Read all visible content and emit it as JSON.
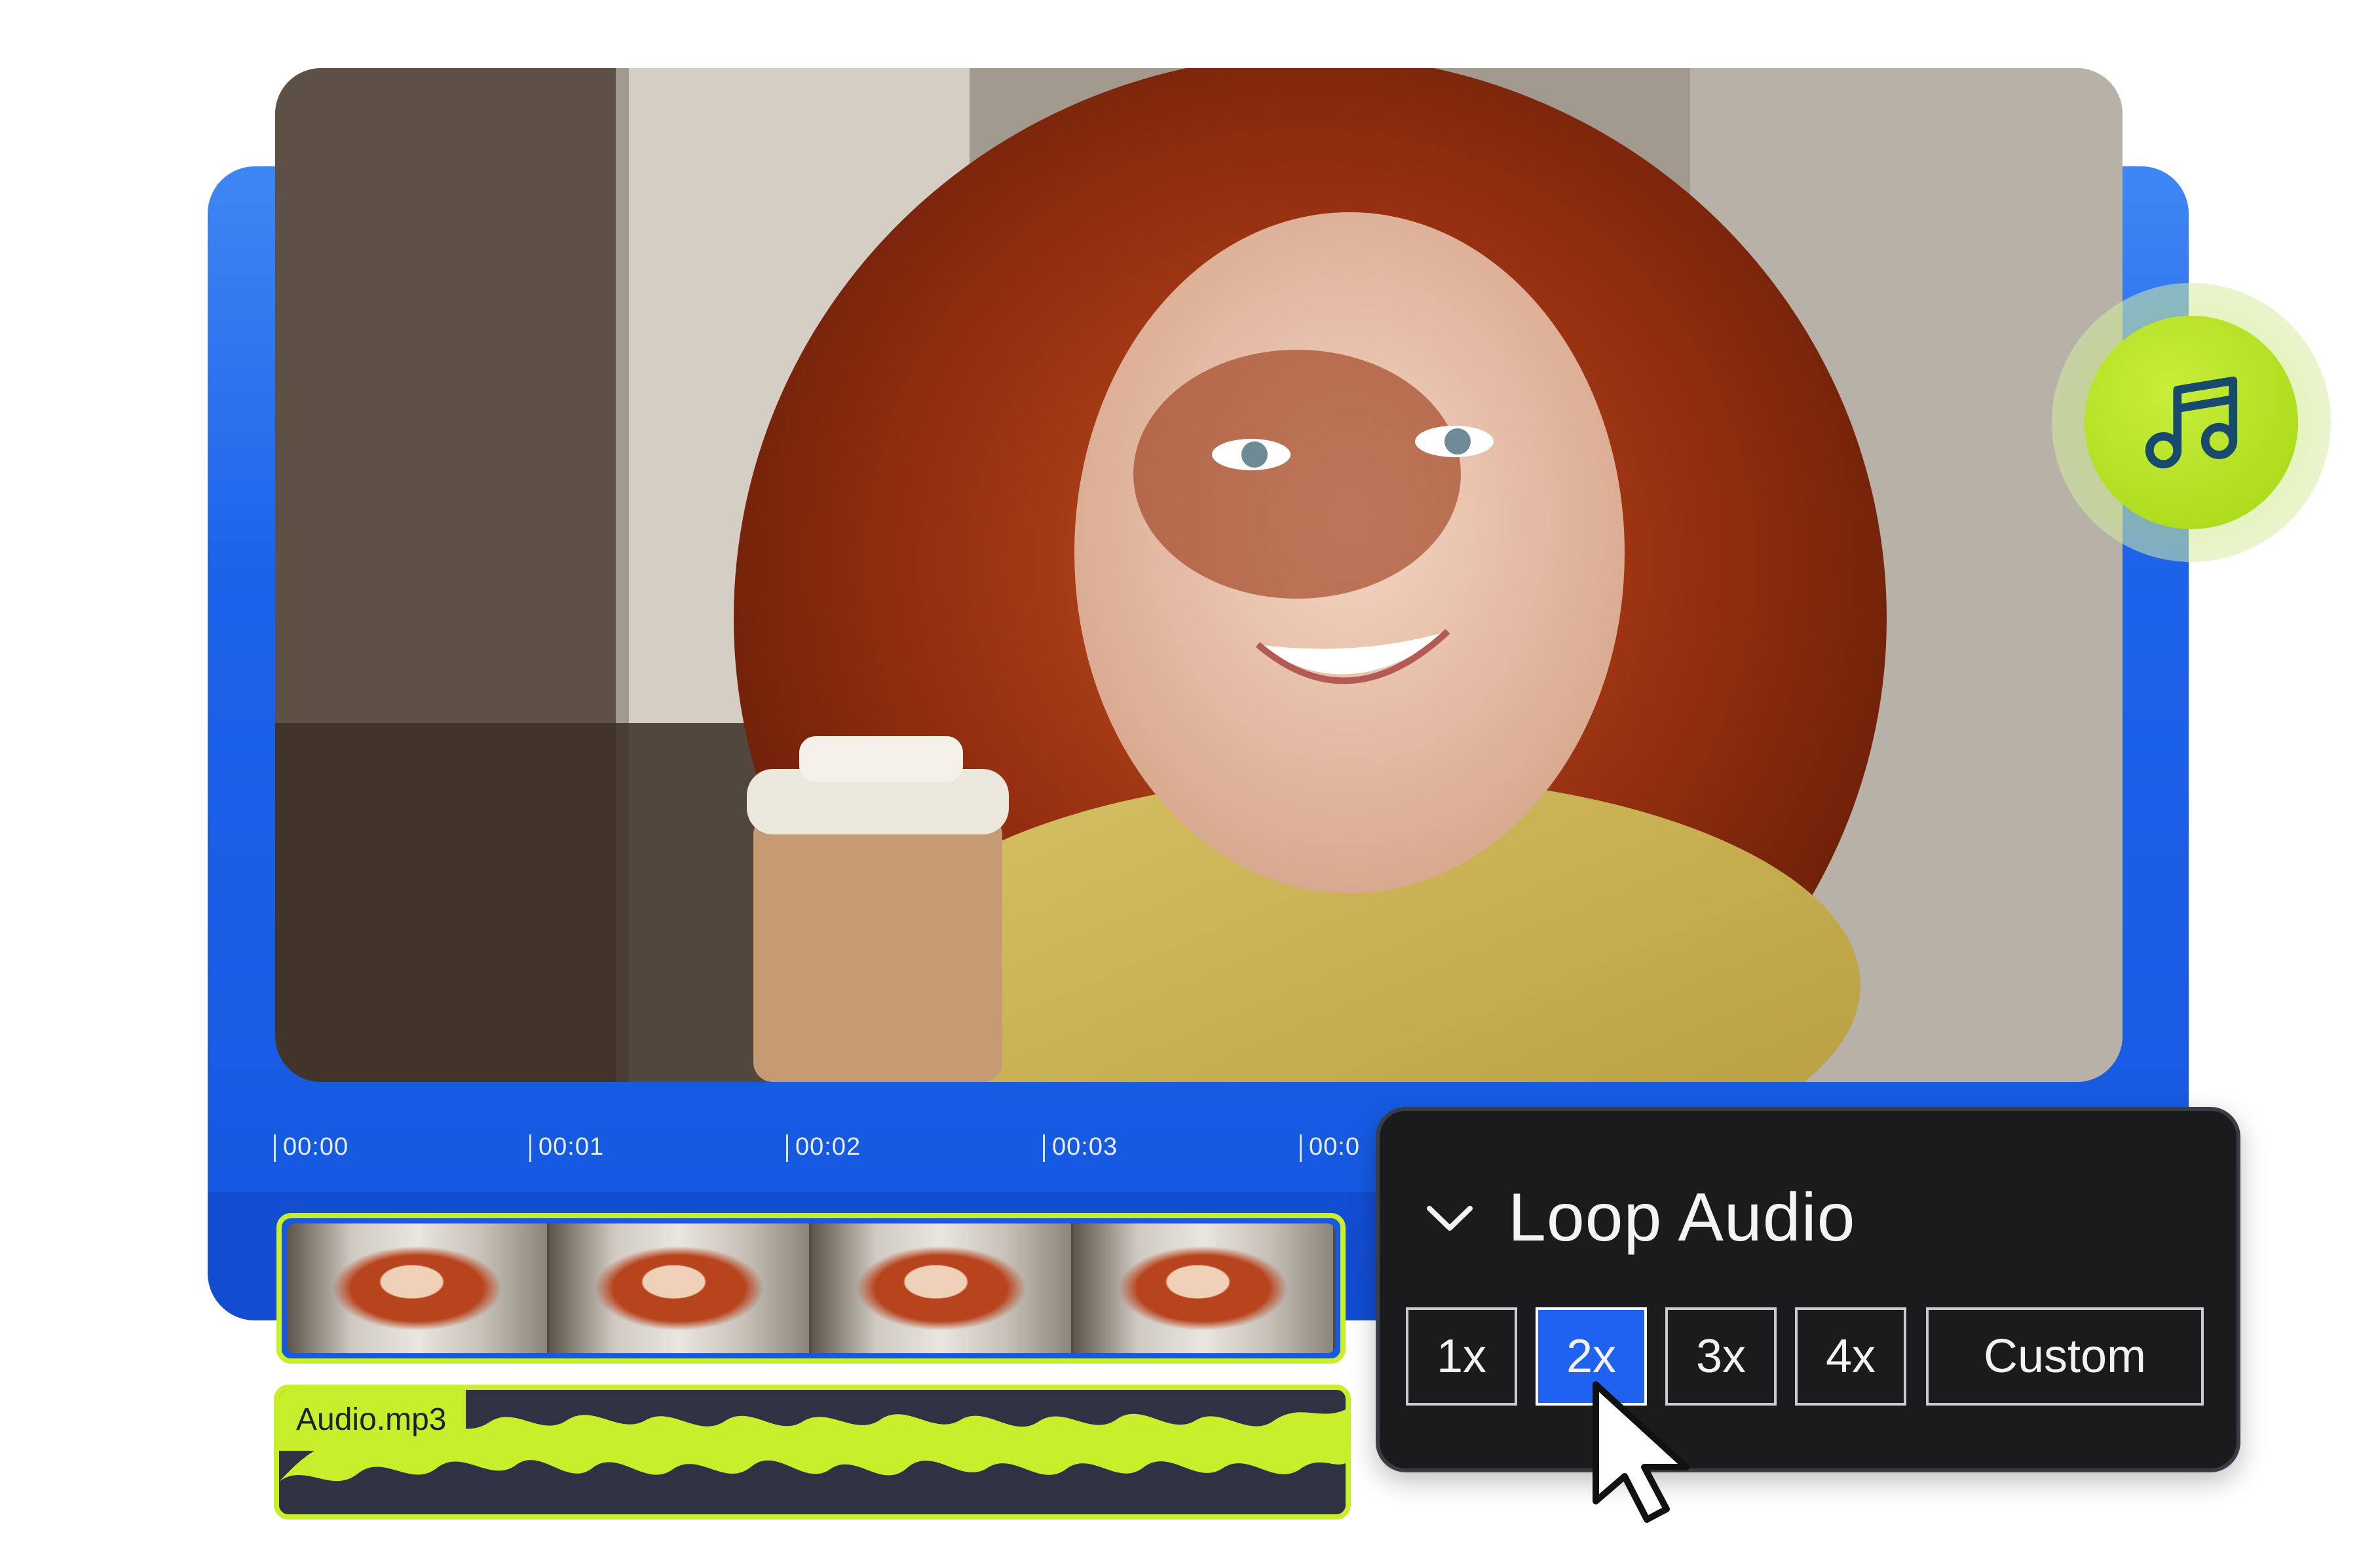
{
  "editor": {
    "timeline": {
      "ticks": [
        "00:00",
        "00:01",
        "00:02",
        "00:03",
        "00:0"
      ]
    },
    "audio_track": {
      "label": "Audio.mp3"
    }
  },
  "loop_panel": {
    "title": "Loop Audio",
    "options": [
      "1x",
      "2x",
      "3x",
      "4x",
      "Custom"
    ],
    "selected": "2x"
  },
  "badge": {
    "icon": "music-note-icon"
  },
  "colors": {
    "accent_blue": "#1f62f0",
    "lime": "#c7ef2c",
    "panel_dark": "#1b1b1e"
  }
}
